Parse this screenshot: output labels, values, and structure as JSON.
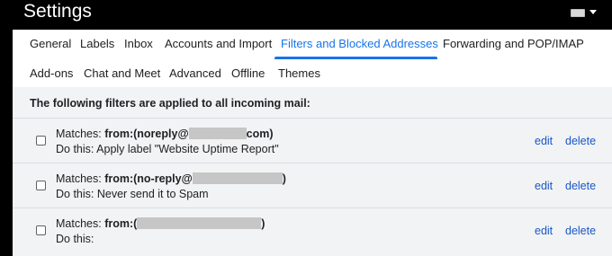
{
  "header": {
    "title": "Settings"
  },
  "tabs_row1": [
    {
      "label": "General",
      "active": false
    },
    {
      "label": "Labels",
      "active": false
    },
    {
      "label": "Inbox",
      "active": false
    },
    {
      "label": "Accounts and Import",
      "active": false
    },
    {
      "label": "Filters and Blocked Addresses",
      "active": true
    },
    {
      "label": "Forwarding and POP/IMAP",
      "active": false
    }
  ],
  "tabs_row2": [
    {
      "label": "Add-ons",
      "active": false
    },
    {
      "label": "Chat and Meet",
      "active": false
    },
    {
      "label": "Advanced",
      "active": false
    },
    {
      "label": "Offline",
      "active": false
    },
    {
      "label": "Themes",
      "active": false
    }
  ],
  "filters": {
    "heading": "The following filters are applied to all incoming mail:",
    "rows": [
      {
        "matches_prefix": "Matches: ",
        "matches_start": "from:(noreply@",
        "matches_end": "com)",
        "do_this": "Do this: Apply label \"Website Uptime Report\"",
        "edit_label": "edit",
        "delete_label": "delete"
      },
      {
        "matches_prefix": "Matches: ",
        "matches_start": "from:(no-reply@",
        "matches_end": ")",
        "do_this": "Do this: Never send it to Spam",
        "edit_label": "edit",
        "delete_label": "delete"
      },
      {
        "matches_prefix": "Matches: ",
        "matches_start": "from:(",
        "matches_end": ")",
        "do_this": "Do this:",
        "edit_label": "edit",
        "delete_label": "delete"
      }
    ]
  },
  "colors": {
    "accent": "#1a73e8",
    "link": "#1a56c8",
    "content_bg": "#f1f3f4",
    "topbar_bg": "#000000"
  }
}
